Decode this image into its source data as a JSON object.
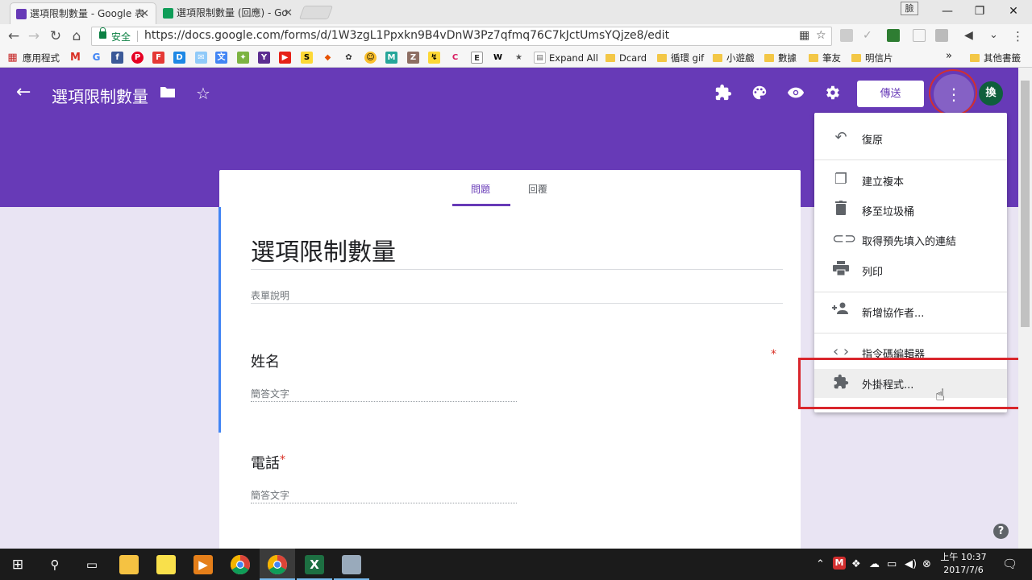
{
  "browser": {
    "tabs": [
      {
        "title": "選項限制數量 - Google 表",
        "fav_color": "#673ab7"
      },
      {
        "title": "選項限制數量 (回應) - Go",
        "fav_color": "#0f9d58"
      }
    ],
    "profile_label": "臉",
    "url_secure_label": "安全",
    "url": "https://docs.google.com/forms/d/1W3zgL1Ppxkn9B4vDnW3Pz7qfmq76C7kJctUmsYQjze8/edit"
  },
  "bookmarks": {
    "apps_label": "應用程式",
    "items": [
      {
        "label": "Expand All"
      },
      {
        "label": "Dcard"
      },
      {
        "label": "循環 gif"
      },
      {
        "label": "小遊戲"
      },
      {
        "label": "數據"
      },
      {
        "label": "筆友"
      },
      {
        "label": "明信片"
      }
    ],
    "overflow": "»",
    "other": "其他書籤"
  },
  "form_header": {
    "title": "選項限制數量",
    "send_label": "傳送",
    "avatar_text": "換"
  },
  "form": {
    "tabs": [
      "問題",
      "回覆"
    ],
    "title": "選項限制數量",
    "description_placeholder": "表單說明",
    "questions": [
      {
        "label": "姓名",
        "required": "*",
        "answer_placeholder": "簡答文字"
      },
      {
        "label": "電話",
        "required": "*",
        "answer_placeholder": "簡答文字"
      }
    ]
  },
  "menu": {
    "items": [
      {
        "icon": "undo-icon",
        "label": "復原"
      },
      {
        "icon": "copy-icon",
        "label": "建立複本"
      },
      {
        "icon": "trash-icon",
        "label": "移至垃圾桶"
      },
      {
        "icon": "link-icon",
        "label": "取得預先填入的連結"
      },
      {
        "icon": "print-icon",
        "label": "列印"
      },
      {
        "icon": "add-people-icon",
        "label": "新增協作者..."
      },
      {
        "icon": "code-icon",
        "label": "指令碼編輯器"
      },
      {
        "icon": "puzzle-icon",
        "label": "外掛程式..."
      }
    ]
  },
  "taskbar": {
    "time": "上午 10:37",
    "date": "2017/7/6"
  },
  "colors": {
    "brand": "#673ab7",
    "highlight_red": "#d9262c"
  }
}
